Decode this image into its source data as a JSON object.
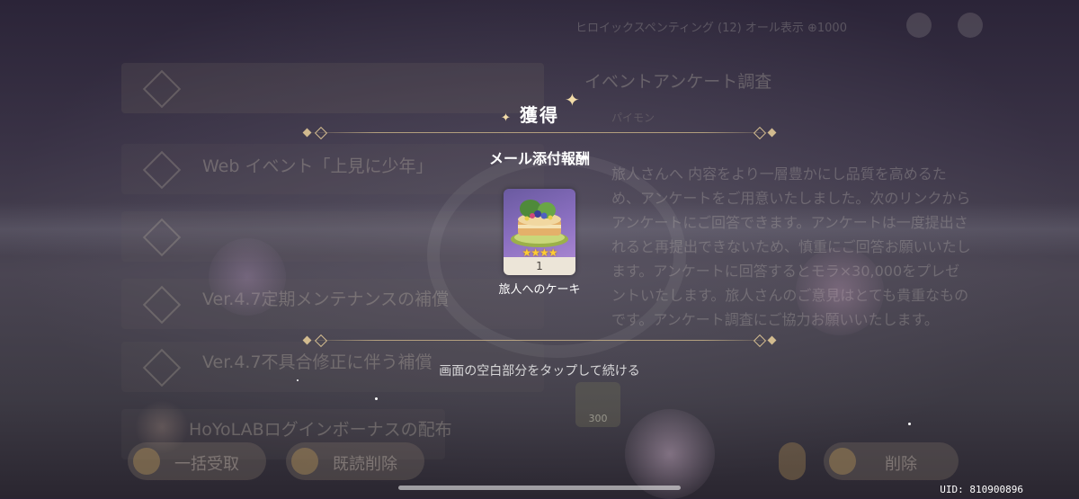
{
  "background": {
    "top_bar_text": "ヒロイックスペンティング  (12) オール表示  ⊕1000",
    "mail_items": [
      {
        "title": "",
        "sub": ""
      },
      {
        "title": "Web イベント「上見に少年」",
        "sub": ""
      },
      {
        "title": "",
        "sub": ""
      },
      {
        "title": "Ver.4.7定期メンテナンスの補償",
        "sub": ""
      },
      {
        "title": "Ver.4.7不具合修正に伴う補償",
        "sub": ""
      },
      {
        "title": "HoYoLABログインボーナスの配布",
        "sub": ""
      }
    ],
    "detail_title": "イベントアンケート調査",
    "detail_sender": "パイモン",
    "detail_body": "旅人さんへ\n内容をより一層豊かにし品質を高めるため、アンケートをご用意いたしました。次のリンクからアンケートにご回答できます。アンケートは一度提出されると再提出できないため、慎重にご回答お願いいたします。アンケートに回答するとモラ×30,000をプレゼントいたします。旅人さんのご意見はとても貴重なものです。アンケート調査にご協力お願いいたします。",
    "reward_chip_count": "300",
    "buttons": {
      "claim_all": "一括受取",
      "delete_read": "既読削除",
      "delete": "削除"
    }
  },
  "overlay": {
    "title": "獲得",
    "subtitle": "メール添付報酬",
    "item": {
      "name": "旅人へのケーキ",
      "count": "1",
      "stars": "★★★★",
      "rarity": 4,
      "icon": "cake-icon"
    },
    "continue_hint": "画面の空白部分をタップして続ける"
  },
  "uid": "UID: 810900896",
  "colors": {
    "accent_gold": "#d7be8c",
    "card_purple": "#8a6fc0",
    "card_footer": "#ece5d8",
    "star": "#ffcc33"
  }
}
